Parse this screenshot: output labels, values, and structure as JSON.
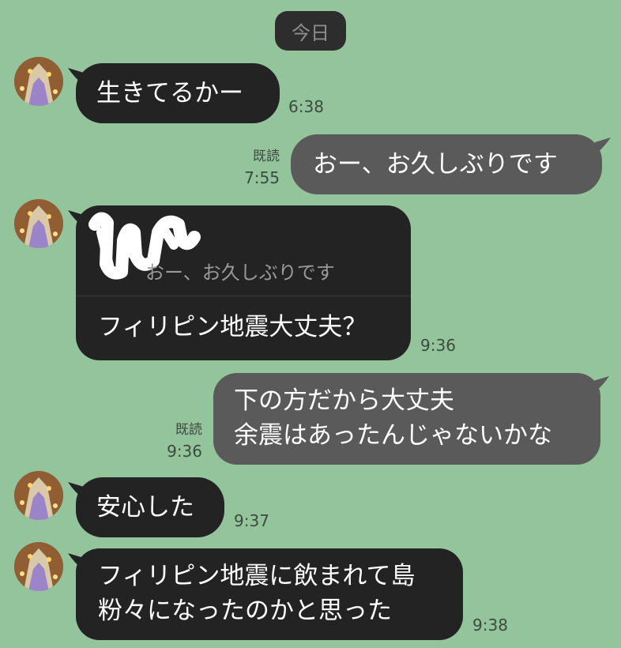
{
  "date_chip": "今日",
  "colors": {
    "background": "#93c49c",
    "incoming_bubble": "#232323",
    "outgoing_bubble": "#5a5a5a"
  },
  "read_label": "既読",
  "messages": [
    {
      "direction": "incoming",
      "text": "生きてるかー",
      "time": "6:38"
    },
    {
      "direction": "outgoing",
      "text": "おー、お久しぶりです",
      "time": "7:55",
      "read": "既読"
    },
    {
      "direction": "incoming",
      "reply_quote": "おー、お久しぶりです",
      "text": "フィリピン地震大丈夫？",
      "time": "9:36"
    },
    {
      "direction": "outgoing",
      "lines": [
        "下の方だから大丈夫",
        "余震はあったんじゃないかな"
      ],
      "time": "9:36",
      "read": "既読"
    },
    {
      "direction": "incoming",
      "text": "安心した",
      "time": "9:37"
    },
    {
      "direction": "incoming",
      "lines": [
        "フィリピン地震に飲まれて島",
        "粉々になったのかと思った"
      ],
      "time": "9:38"
    }
  ]
}
